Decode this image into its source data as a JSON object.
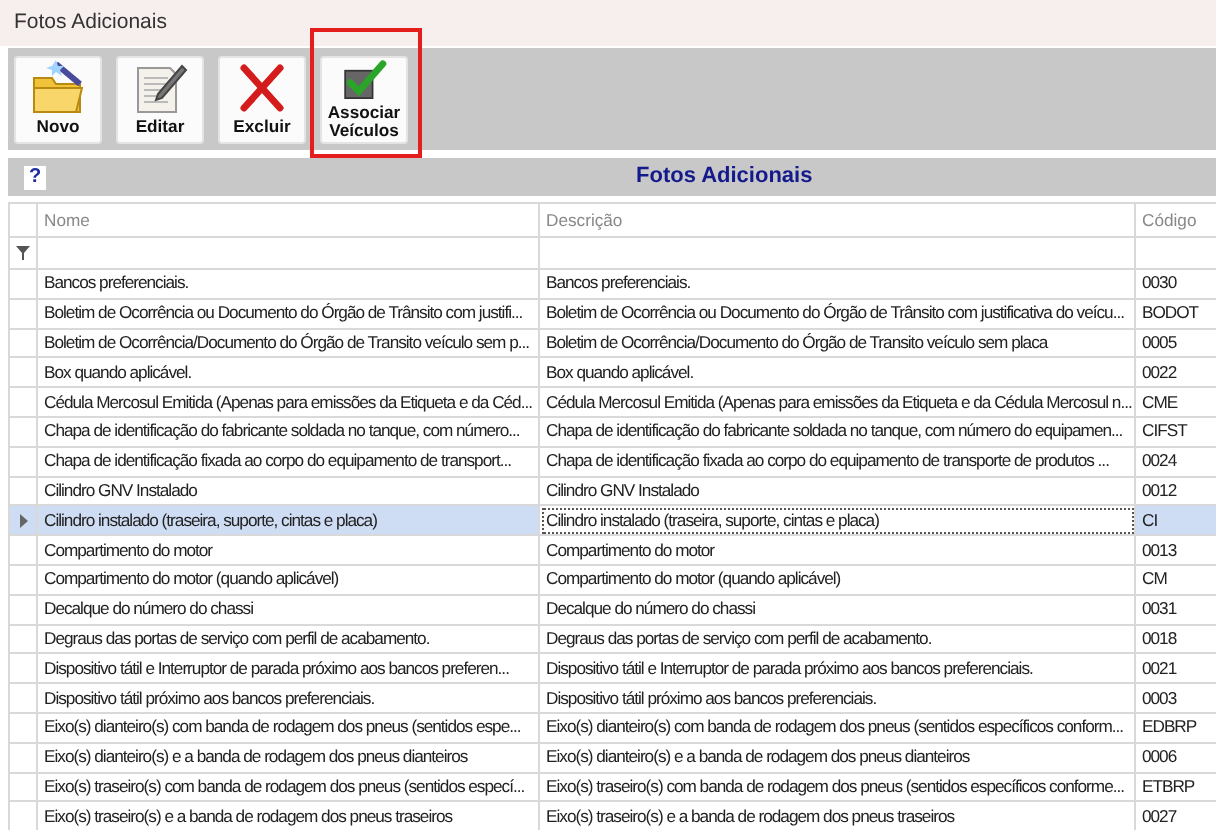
{
  "window": {
    "title": "Fotos Adicionais"
  },
  "toolbar": [
    {
      "label": "Novo",
      "kind": "new",
      "highlighted": false
    },
    {
      "label": "Editar",
      "kind": "edit",
      "highlighted": false
    },
    {
      "label": "Excluir",
      "kind": "delete",
      "highlighted": false
    },
    {
      "label": "Associar Veículos",
      "kind": "associate",
      "highlighted": true
    }
  ],
  "panel": {
    "help": "?",
    "title": "Fotos Adicionais"
  },
  "table": {
    "columns": [
      "Nome",
      "Descrição",
      "Código"
    ],
    "rows": [
      {
        "cells": [
          "Bancos preferenciais.",
          "Bancos preferenciais.",
          "0030"
        ],
        "selected": false
      },
      {
        "cells": [
          "Boletim de Ocorrência ou Documento do Órgão de Trânsito com justifi...",
          "Boletim de Ocorrência ou Documento do Órgão de Trânsito com justificativa do veícu...",
          "BODOT"
        ],
        "selected": false
      },
      {
        "cells": [
          "Boletim de Ocorrência/Documento do Órgão de Transito veículo sem p...",
          "Boletim de Ocorrência/Documento do Órgão de Transito veículo sem placa",
          "0005"
        ],
        "selected": false
      },
      {
        "cells": [
          "Box quando aplicável.",
          "Box quando aplicável.",
          "0022"
        ],
        "selected": false
      },
      {
        "cells": [
          "Cédula Mercosul Emitida (Apenas para emissões da Etiqueta e da Céd...",
          "Cédula Mercosul Emitida (Apenas para emissões da Etiqueta e da Cédula Mercosul n...",
          "CME"
        ],
        "selected": false
      },
      {
        "cells": [
          "Chapa de identificação do fabricante soldada no tanque, com número...",
          "Chapa de identificação do fabricante soldada no tanque, com número do equipamen...",
          "CIFST"
        ],
        "selected": false
      },
      {
        "cells": [
          "Chapa de identificação fixada ao corpo do equipamento de transport...",
          "Chapa de identificação fixada ao corpo do equipamento de transporte de produtos ...",
          "0024"
        ],
        "selected": false
      },
      {
        "cells": [
          "Cilindro GNV Instalado",
          "Cilindro GNV Instalado",
          "0012"
        ],
        "selected": false
      },
      {
        "cells": [
          "Cilindro instalado (traseira, suporte, cintas e placa)",
          "Cilindro instalado (traseira, suporte, cintas e placa)",
          "CI"
        ],
        "selected": true
      },
      {
        "cells": [
          "Compartimento do motor",
          "Compartimento do motor",
          "0013"
        ],
        "selected": false
      },
      {
        "cells": [
          "Compartimento do motor (quando aplicável)",
          "Compartimento do motor (quando aplicável)",
          "CM"
        ],
        "selected": false
      },
      {
        "cells": [
          "Decalque do número do chassi",
          "Decalque do número do chassi",
          "0031"
        ],
        "selected": false
      },
      {
        "cells": [
          "Degraus das portas de serviço com perfil de acabamento.",
          "Degraus das portas de serviço com perfil de acabamento.",
          "0018"
        ],
        "selected": false
      },
      {
        "cells": [
          "Dispositivo tátil e Interruptor de parada próximo aos bancos preferen...",
          "Dispositivo tátil e Interruptor de parada próximo aos bancos preferenciais.",
          "0021"
        ],
        "selected": false
      },
      {
        "cells": [
          "Dispositivo tátil próximo aos bancos preferenciais.",
          "Dispositivo tátil próximo aos bancos preferenciais.",
          "0003"
        ],
        "selected": false
      },
      {
        "cells": [
          "Eixo(s) dianteiro(s) com banda de rodagem dos pneus (sentidos espe...",
          "Eixo(s) dianteiro(s) com banda de rodagem dos pneus (sentidos específicos conform...",
          "EDBRP"
        ],
        "selected": false
      },
      {
        "cells": [
          "Eixo(s) dianteiro(s) e a banda de rodagem dos pneus dianteiros",
          "Eixo(s) dianteiro(s) e a banda de rodagem dos pneus dianteiros",
          "0006"
        ],
        "selected": false
      },
      {
        "cells": [
          "Eixo(s) traseiro(s) com banda de rodagem dos pneus (sentidos especí...",
          "Eixo(s) traseiro(s) com banda de rodagem dos pneus (sentidos específicos conforme...",
          "ETBRP"
        ],
        "selected": false
      },
      {
        "cells": [
          "Eixo(s) traseiro(s) e a banda de rodagem dos pneus traseiros",
          "Eixo(s) traseiro(s) e a banda de rodagem dos pneus traseiros",
          "0027"
        ],
        "selected": false
      }
    ]
  }
}
